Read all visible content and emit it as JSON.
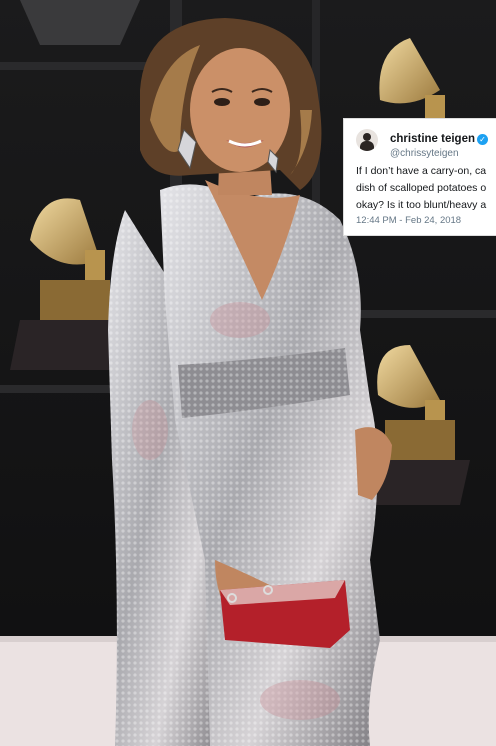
{
  "photo": {
    "subject": "woman in silver sequin gown with red clutch",
    "palette": {
      "background": "#141414",
      "gown": "#c9c9cc",
      "hair": "#6b4a2e",
      "clutch": "#b4202a",
      "trophy": "#c8a66a",
      "floor": "#e9dede"
    }
  },
  "tweet": {
    "display_name": "christine teigen",
    "handle": "@chrissyteigen",
    "text_lines": [
      "If I don’t have a carry-on, ca",
      "dish of scalloped potatoes o",
      "okay? Is it too blunt/heavy a"
    ],
    "timestamp": "12:44 PM - Feb 24, 2018",
    "verified_icon": "check-badge-icon",
    "colors": {
      "verified": "#1da1f2",
      "meta": "#657786",
      "text": "#14171a"
    }
  }
}
